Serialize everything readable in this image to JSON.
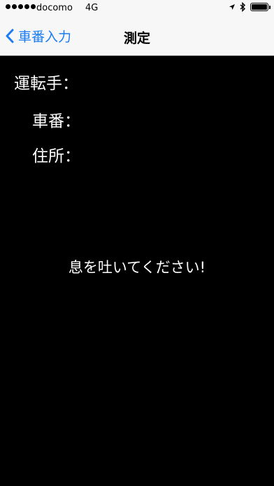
{
  "status_bar": {
    "carrier": "docomo",
    "network": "4G",
    "signal_dots": 5,
    "icons": [
      "location-arrow-icon",
      "bluetooth-icon",
      "battery-icon"
    ],
    "battery_level": 1.0
  },
  "nav": {
    "back_label": "車番入力",
    "title": "測定"
  },
  "info": {
    "driver_label": "運転手：",
    "car_number_label": "車番：",
    "address_label": "住所："
  },
  "message": "息を吐いてください!",
  "colors": {
    "accent": "#1a7cf5",
    "background": "#000000",
    "nav_background": "#f7f7f7",
    "text_light": "#ffffff"
  }
}
